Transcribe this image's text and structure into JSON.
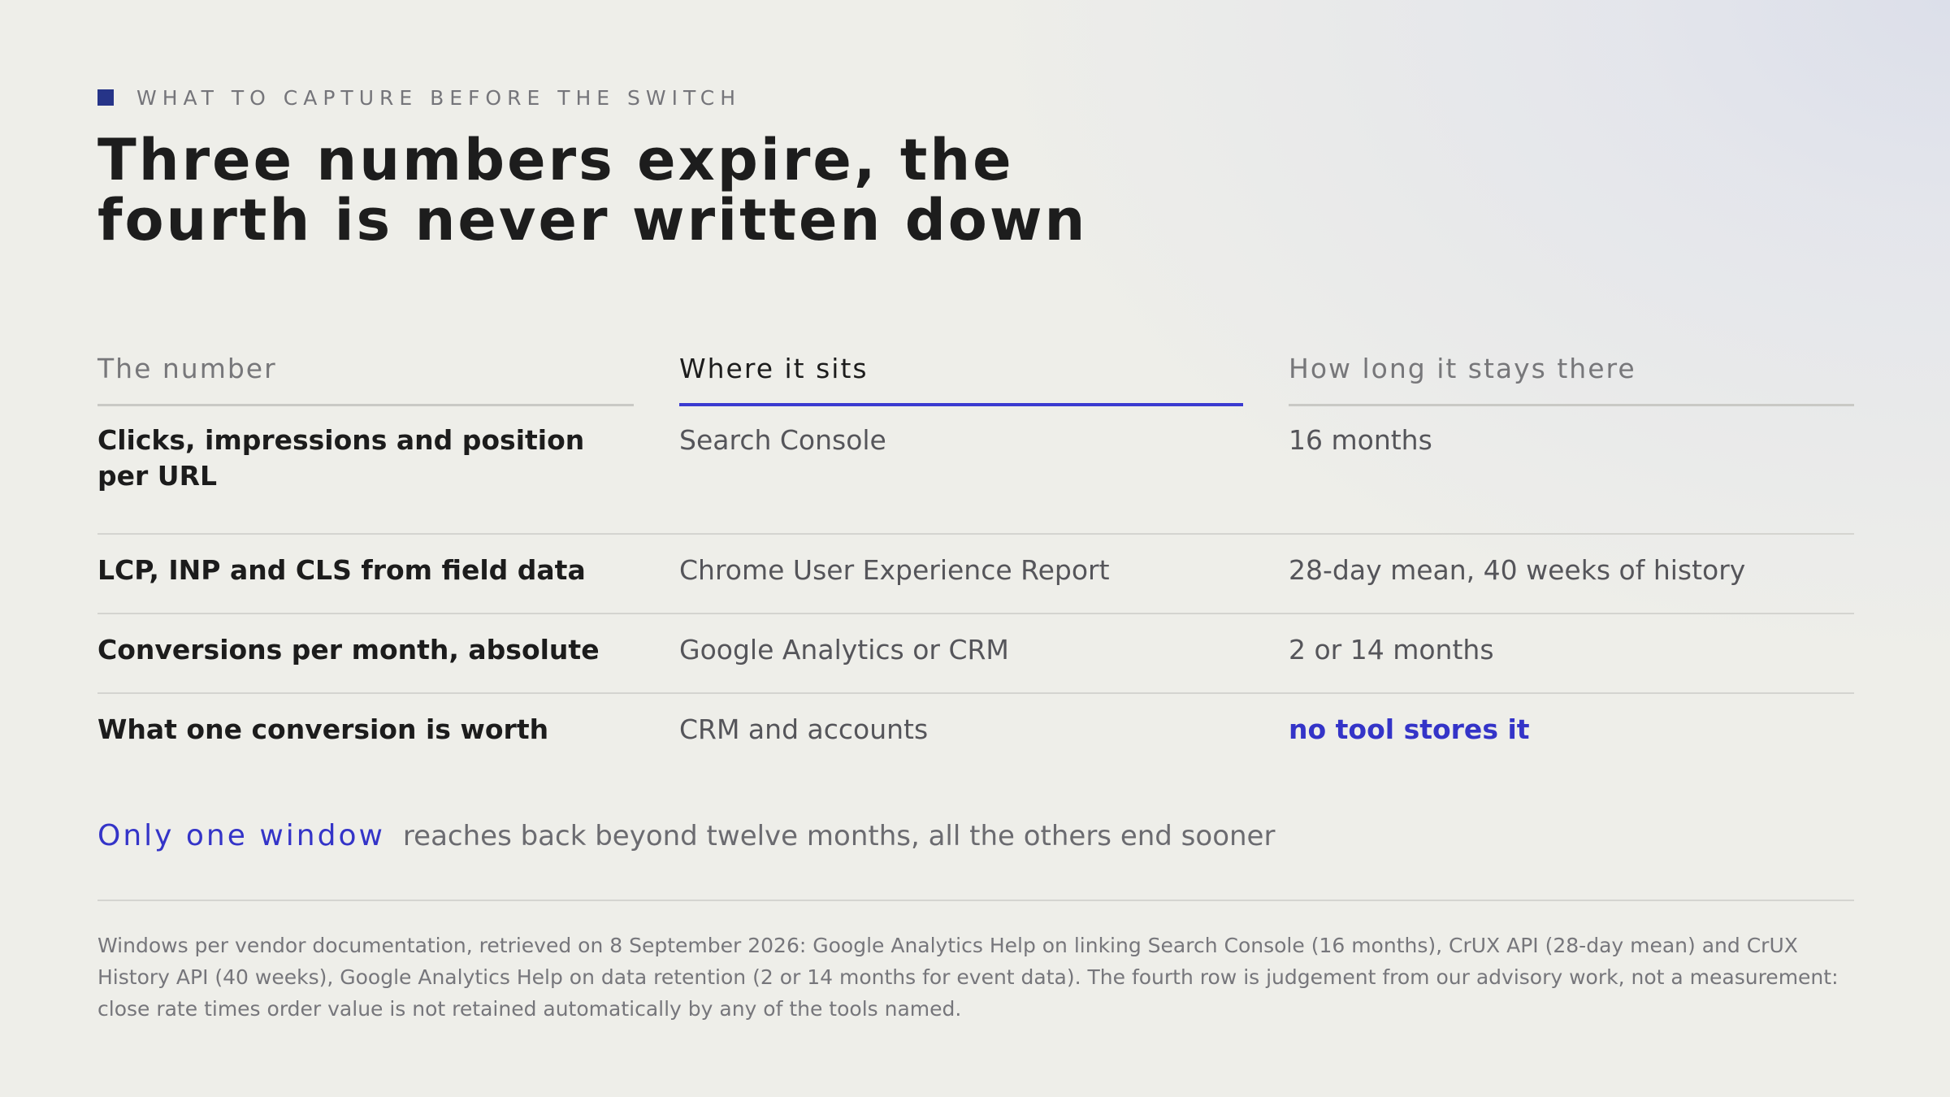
{
  "eyebrow": {
    "text": "WHAT TO CAPTURE BEFORE THE SWITCH"
  },
  "title": {
    "line1": "Three numbers expire, the",
    "line2": "fourth is never written down"
  },
  "table": {
    "headers": [
      "The number",
      "Where it sits",
      "How long it stays there"
    ],
    "active_header_index": 1,
    "rows": [
      {
        "number": "Clicks, impressions and position per URL",
        "where": "Search Console",
        "how_long": "16 months"
      },
      {
        "number": "LCP, INP and CLS from field data",
        "where": "Chrome User Experience Report",
        "how_long": "28-day mean, 40 weeks of history"
      },
      {
        "number": "Conversions per month, absolute",
        "where": "Google Analytics or CRM",
        "how_long": "2 or 14 months"
      },
      {
        "number": "What one conversion is worth",
        "where": "CRM and accounts",
        "how_long": "no tool stores it"
      }
    ]
  },
  "summary": {
    "lead": "Only one window",
    "rest": "reaches back beyond twelve months, all the others end sooner"
  },
  "footnote": "Windows per vendor documentation, retrieved on 8 September 2026: Google Analytics Help on linking Search Console (16 months), CrUX API (28-day mean) and CrUX History API (40 weeks), Google Analytics Help on data retention (2 or 14 months for event data). The fourth row is judgement from our advisory work, not a measurement: close rate times order value is not retained automatically by any of the tools named.",
  "colors": {
    "accent": "#3434c8",
    "eyebrow_mark": "#263488",
    "text": "#1c1c1c",
    "muted": "#77777a",
    "background": "#eeeee9"
  },
  "icons": {
    "eyebrow_mark": "square-marker-icon"
  }
}
